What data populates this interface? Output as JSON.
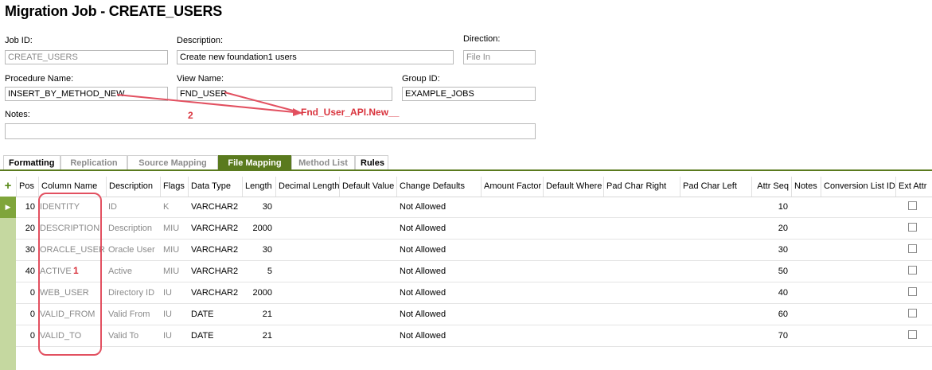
{
  "title": "Migration Job - CREATE_USERS",
  "form": {
    "job_id": {
      "label": "Job ID:",
      "value": "CREATE_USERS"
    },
    "description": {
      "label": "Description:",
      "value": "Create new foundation1 users"
    },
    "direction": {
      "label": "Direction:",
      "value": "File In"
    },
    "procedure_name": {
      "label": "Procedure Name:",
      "value": "INSERT_BY_METHOD_NEW"
    },
    "view_name": {
      "label": "View Name:",
      "value": "FND_USER"
    },
    "group_id": {
      "label": "Group ID:",
      "value": "EXAMPLE_JOBS"
    },
    "notes": {
      "label": "Notes:",
      "value": ""
    }
  },
  "annotations": {
    "method": "Fnd_User_API.New__",
    "num2": "2",
    "num1": "1"
  },
  "tabs": [
    "Formatting",
    "Replication",
    "Source Mapping",
    "File Mapping",
    "Method List",
    "Rules"
  ],
  "columns": [
    "Pos",
    "Column Name",
    "Description",
    "Flags",
    "Data Type",
    "Length",
    "Decimal Length",
    "Default Value",
    "Change Defaults",
    "Amount Factor",
    "Default Where",
    "Pad Char Right",
    "Pad Char Left",
    "Attr Seq",
    "Notes",
    "Conversion List ID",
    "Ext Attr"
  ],
  "rows": [
    {
      "pos": "10",
      "col": "IDENTITY",
      "desc": "ID",
      "flags": "K",
      "type": "VARCHAR2",
      "len": "30",
      "change": "Not Allowed",
      "seq": "10"
    },
    {
      "pos": "20",
      "col": "DESCRIPTION",
      "desc": "Description",
      "flags": "MIU",
      "type": "VARCHAR2",
      "len": "2000",
      "change": "Not Allowed",
      "seq": "20"
    },
    {
      "pos": "30",
      "col": "ORACLE_USER",
      "desc": "Oracle User",
      "flags": "MIU",
      "type": "VARCHAR2",
      "len": "30",
      "change": "Not Allowed",
      "seq": "30"
    },
    {
      "pos": "40",
      "col": "ACTIVE",
      "desc": "Active",
      "flags": "MIU",
      "type": "VARCHAR2",
      "len": "5",
      "change": "Not Allowed",
      "seq": "50"
    },
    {
      "pos": "0",
      "col": "WEB_USER",
      "desc": "Directory ID",
      "flags": "IU",
      "type": "VARCHAR2",
      "len": "2000",
      "change": "Not Allowed",
      "seq": "40"
    },
    {
      "pos": "0",
      "col": "VALID_FROM",
      "desc": "Valid From",
      "flags": "IU",
      "type": "DATE",
      "len": "21",
      "change": "Not Allowed",
      "seq": "60"
    },
    {
      "pos": "0",
      "col": "VALID_TO",
      "desc": "Valid To",
      "flags": "IU",
      "type": "DATE",
      "len": "21",
      "change": "Not Allowed",
      "seq": "70"
    }
  ],
  "colors": {
    "accent": "#5a7a1e",
    "annotation": "#d9343e"
  }
}
